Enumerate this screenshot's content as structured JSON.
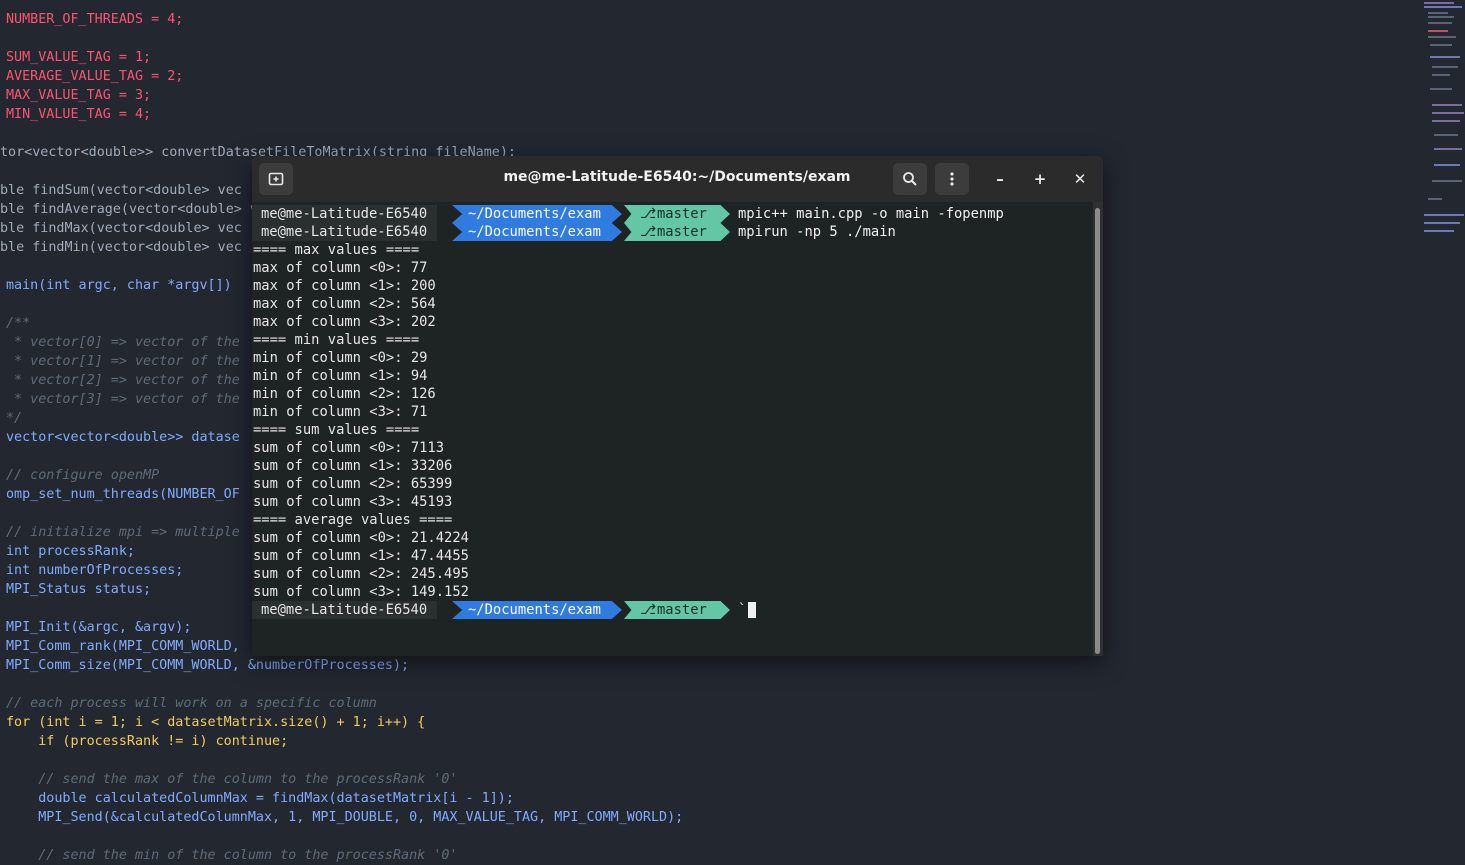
{
  "editor": {
    "l01": "NUMBER_OF_THREADS = 4;",
    "l03a": "SUM_VALUE_TAG = 1;",
    "l03b": "AVERAGE_VALUE_TAG = 2;",
    "l03c": "MAX_VALUE_TAG = 3;",
    "l03d": "MIN_VALUE_TAG = 4;",
    "l08": "tor<vector<double>> convertDatasetFileToMatrix(string fileName);",
    "l10": "ble findSum(vector<double> vec",
    "l11": "ble findAverage(vector<double> vec",
    "l12": "ble findMax(vector<double> vec",
    "l13": "ble findMin(vector<double> vec",
    "l15": "main(int argc, char *argv[])",
    "l17": "/**",
    "l18": " * vector[0] => vector of the",
    "l19": " * vector[1] => vector of the",
    "l20": " * vector[2] => vector of the",
    "l21": " * vector[3] => vector of the",
    "l22": "*/",
    "l23": "vector<vector<double>> datase",
    "l25": "// configure openMP",
    "l26": "omp_set_num_threads(NUMBER_OF",
    "l28": "// initialize mpi => multiple",
    "l29": "int processRank;",
    "l30": "int numberOfProcesses;",
    "l31": "MPI_Status status;",
    "l33": "MPI_Init(&argc, &argv);",
    "l34": "MPI_Comm_rank(MPI_COMM_WORLD,",
    "l35": "MPI_Comm_size(MPI_COMM_WORLD, &numberOfProcesses);",
    "l37": "// each process will work on a specific column",
    "l38": "for (int i = 1; i < datasetMatrix.size() + 1; i++) {",
    "l39": "    if (processRank != i) continue;",
    "l41": "    // send the max of the column to the processRank '0'",
    "l42": "    double calculatedColumnMax = findMax(datasetMatrix[i - 1]);",
    "l43": "    MPI_Send(&calculatedColumnMax, 1, MPI_DOUBLE, 0, MAX_VALUE_TAG, MPI_COMM_WORLD);",
    "l45": "    // send the min of the column to the processRank '0'"
  },
  "terminal": {
    "title": "me@me-Latitude-E6540:~/Documents/exam",
    "new_tab_icon": "new-tab-icon",
    "search_icon": "search-icon",
    "menu_icon": "kebab-menu-icon",
    "minimize_glyph": "–",
    "maximize_glyph": "+",
    "close_glyph": "✕",
    "prompt": {
      "user_host": "me@me-Latitude-E6540",
      "directory": "~/Documents/exam",
      "git_icon": "git-branch-icon",
      "git_glyph": "⎇",
      "branch": "master"
    },
    "commands": [
      "mpic++ main.cpp -o main -fopenmp",
      "mpirun -np 5 ./main"
    ],
    "final_prompt_char": "`",
    "output": [
      "==== max values ====",
      "max of column <0>: 77",
      "max of column <1>: 200",
      "max of column <2>: 564",
      "max of column <3>: 202",
      "==== min values ====",
      "min of column <0>: 29",
      "min of column <1>: 94",
      "min of column <2>: 126",
      "min of column <3>: 71",
      "==== sum values ====",
      "sum of column <0>: 7113",
      "sum of column <1>: 33206",
      "sum of column <2>: 65399",
      "sum of column <3>: 45193",
      "==== average values ====",
      "sum of column <0>: 21.4224",
      "sum of column <1>: 47.4455",
      "sum of column <2>: 245.495",
      "sum of column <3>: 149.152"
    ]
  },
  "colors": {
    "editor_bg": "#232830",
    "terminal_bg": "#1e2424",
    "titlebar_bg": "#2b2b2b",
    "prompt_dir_bg": "#2f7be0",
    "prompt_git_bg": "#63c7a6"
  }
}
